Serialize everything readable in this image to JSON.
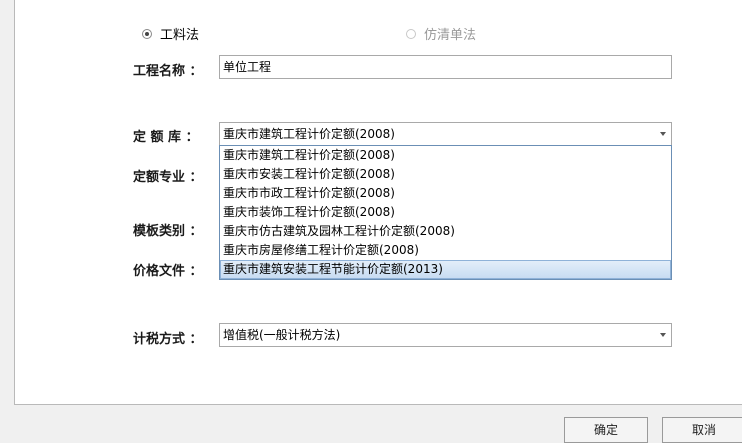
{
  "mode": {
    "option_bill": "工料法",
    "option_quote": "仿清单法"
  },
  "form": {
    "project_name_label": "工程名称 ：",
    "project_name_value": "单位工程",
    "quota_lib_label": "定 额 库 ：",
    "quota_lib_value": "重庆市建筑工程计价定额(2008)",
    "quota_major_label": "定额专业 ：",
    "template_label": "模板类别 ：",
    "price_file_label": "价格文件 ：",
    "tax_label": "计税方式 ：",
    "tax_value": "增值税(一般计税方法)"
  },
  "dropdown": {
    "options": [
      "重庆市建筑工程计价定额(2008)",
      "重庆市安装工程计价定额(2008)",
      "重庆市市政工程计价定额(2008)",
      "重庆市装饰工程计价定额(2008)",
      "重庆市仿古建筑及园林工程计价定额(2008)",
      "重庆市房屋修缮工程计价定额(2008)",
      "重庆市建筑安装工程节能计价定额(2013)"
    ],
    "highlighted_index": 6
  },
  "buttons": {
    "ok": "确定",
    "cancel": "取消"
  },
  "colors": {
    "highlight": "#c8dcf2",
    "border": "#a9a9a9",
    "background": "#f0f0f0"
  }
}
